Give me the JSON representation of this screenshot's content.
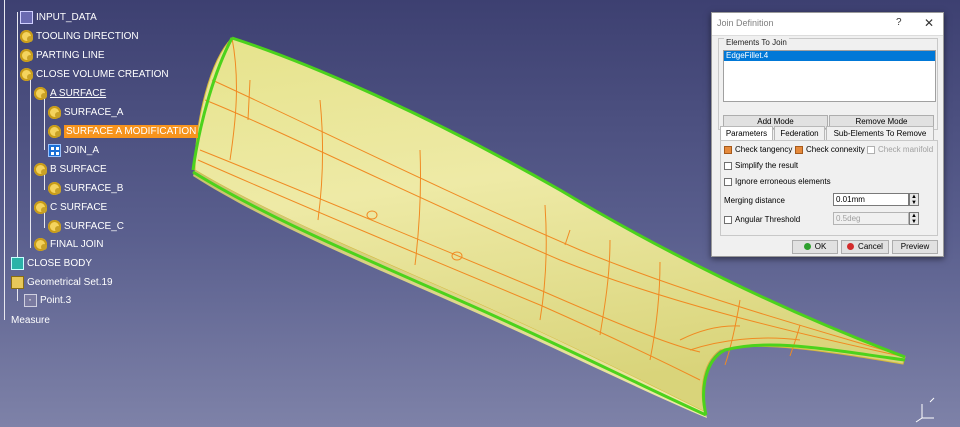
{
  "tree": {
    "nodes": [
      {
        "id": "input-data",
        "label": "INPUT_DATA",
        "icon": "input-data-icon"
      },
      {
        "id": "tooling-direction",
        "label": "TOOLING DIRECTION",
        "icon": "gear-icon"
      },
      {
        "id": "parting-line",
        "label": "PARTING LINE",
        "icon": "gear-icon"
      },
      {
        "id": "close-volume-creation",
        "label": "CLOSE VOLUME CREATION",
        "icon": "gear-icon"
      },
      {
        "id": "a-surface",
        "label": "A SURFACE",
        "icon": "gear-icon"
      },
      {
        "id": "surface-a",
        "label": "SURFACE_A",
        "icon": "gear-icon"
      },
      {
        "id": "surface-a-modification",
        "label": "SURFACE A MODIFICATION",
        "icon": "gear-icon"
      },
      {
        "id": "join-a",
        "label": "JOIN_A",
        "icon": "join-icon"
      },
      {
        "id": "b-surface",
        "label": "B SURFACE",
        "icon": "gear-icon"
      },
      {
        "id": "surface-b",
        "label": "SURFACE_B",
        "icon": "gear-icon"
      },
      {
        "id": "c-surface",
        "label": "C SURFACE",
        "icon": "gear-icon"
      },
      {
        "id": "surface-c",
        "label": "SURFACE_C",
        "icon": "gear-icon"
      },
      {
        "id": "final-join",
        "label": "FINAL JOIN",
        "icon": "gear-icon"
      },
      {
        "id": "close-body",
        "label": "CLOSE BODY",
        "icon": "body-icon"
      },
      {
        "id": "geometrical-set",
        "label": "Geometrical Set.19",
        "icon": "geometrical-set-icon"
      },
      {
        "id": "point",
        "label": "Point.3",
        "icon": "point-icon"
      },
      {
        "id": "measure",
        "label": "Measure",
        "icon": "measure-icon"
      }
    ],
    "selected": "SURFACE A MODIFICATION"
  },
  "dialog": {
    "title": "Join Definition",
    "help": "?",
    "close": "✕",
    "elements_to_join": {
      "label": "Elements To Join",
      "items": [
        "EdgeFillet.4"
      ]
    },
    "add_mode": "Add Mode",
    "remove_mode": "Remove Mode",
    "tabs": [
      "Parameters",
      "Federation",
      "Sub-Elements To Remove"
    ],
    "active_tab": "Parameters",
    "check_tangency": "Check tangency",
    "check_connexity": "Check connexity",
    "check_manifold": "Check manifold",
    "simplify": "Simplify the result",
    "ignore_erroneous": "Ignore erroneous elements",
    "merging_distance_label": "Merging distance",
    "merging_distance_value": "0.01mm",
    "angular_threshold_label": "Angular Threshold",
    "angular_threshold_value": "0.5deg",
    "ok": "OK",
    "cancel": "Cancel",
    "preview": "Preview"
  },
  "colors": {
    "background_top": "#3d4071",
    "selection": "#f7941d",
    "surface": "#e8e59a",
    "edges": "#f08a22",
    "boundary": "#4cd21c"
  }
}
